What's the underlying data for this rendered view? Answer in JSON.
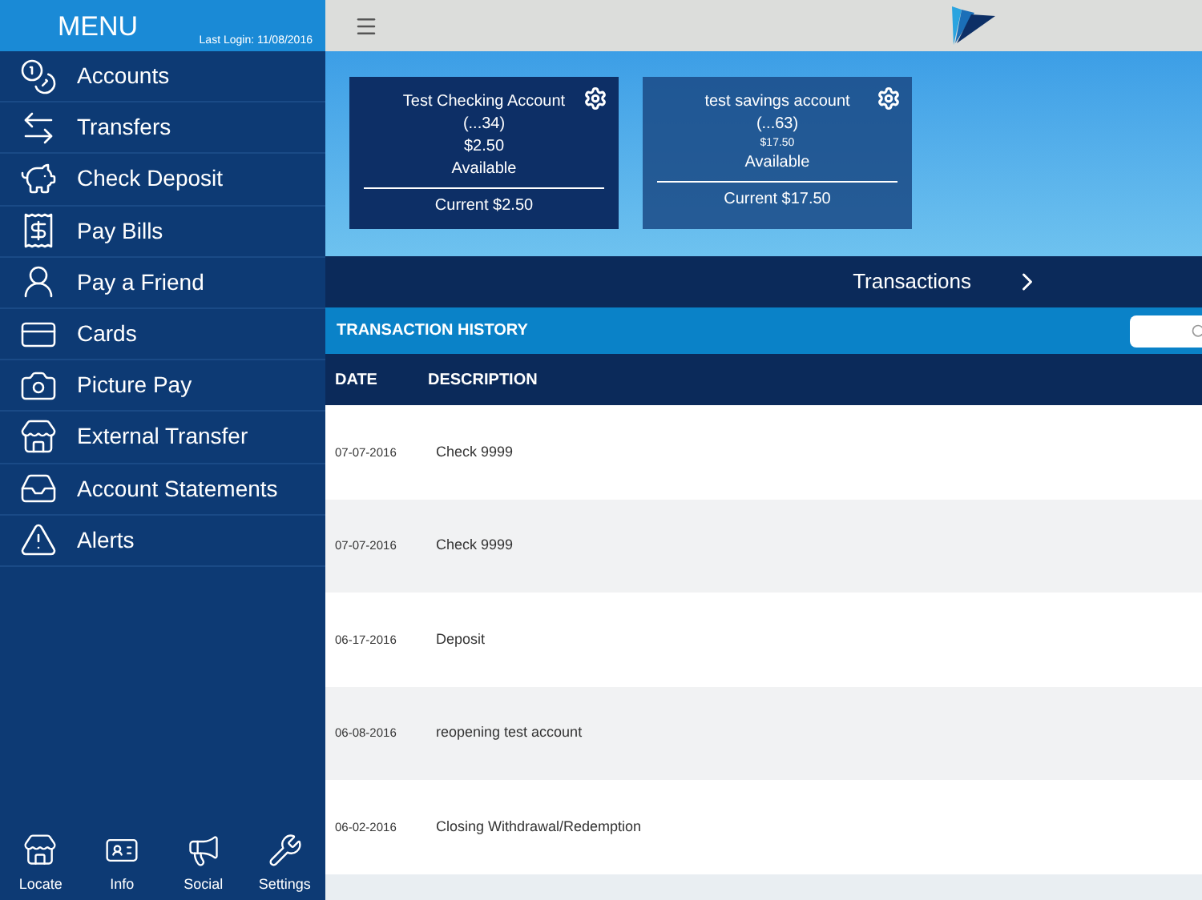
{
  "sidebar": {
    "title": "MENU",
    "last_login": "Last Login: 11/08/2016",
    "items": [
      {
        "label": "Accounts"
      },
      {
        "label": "Transfers"
      },
      {
        "label": "Check Deposit"
      },
      {
        "label": "Pay Bills"
      },
      {
        "label": "Pay a Friend"
      },
      {
        "label": "Cards"
      },
      {
        "label": "Picture Pay"
      },
      {
        "label": "External Transfer"
      },
      {
        "label": "Account Statements"
      },
      {
        "label": "Alerts"
      }
    ],
    "bottom_nav": [
      {
        "label": "Locate"
      },
      {
        "label": "Info"
      },
      {
        "label": "Social"
      },
      {
        "label": "Settings"
      }
    ]
  },
  "accounts": [
    {
      "name": "Test Checking Account",
      "number": "(...34)",
      "amount": "$2.50",
      "available": "Available",
      "current": "Current $2.50",
      "selected": true
    },
    {
      "name": "test savings account",
      "number": "(...63)",
      "amount": "$17.50",
      "available": "Available",
      "current": "Current $17.50",
      "selected": false
    }
  ],
  "transactions_link": "Transactions",
  "history": {
    "title": "TRANSACTION HISTORY",
    "columns": [
      "DATE",
      "DESCRIPTION"
    ],
    "rows": [
      {
        "date": "07-07-2016",
        "description": "Check 9999"
      },
      {
        "date": "07-07-2016",
        "description": "Check 9999"
      },
      {
        "date": "06-17-2016",
        "description": "Deposit"
      },
      {
        "date": "06-08-2016",
        "description": "reopening test account"
      },
      {
        "date": "06-02-2016",
        "description": "Closing Withdrawal/Redemption"
      }
    ]
  }
}
